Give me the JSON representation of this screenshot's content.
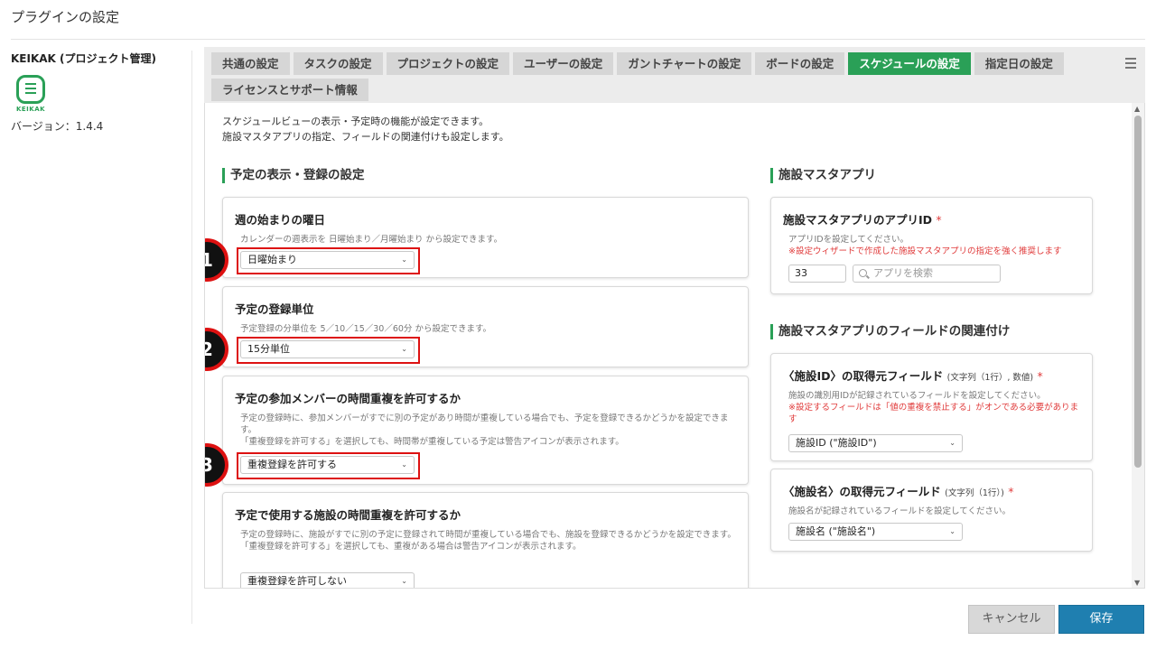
{
  "page_title": "プラグインの設定",
  "sidebar": {
    "plugin_name": "KEIKAK (プロジェクト管理)",
    "logo_text": "KEIKAK",
    "version": "バージョン：1.4.4"
  },
  "tabs": [
    {
      "label": "共通の設定",
      "active": false
    },
    {
      "label": "タスクの設定",
      "active": false
    },
    {
      "label": "プロジェクトの設定",
      "active": false
    },
    {
      "label": "ユーザーの設定",
      "active": false
    },
    {
      "label": "ガントチャートの設定",
      "active": false
    },
    {
      "label": "ボードの設定",
      "active": false
    },
    {
      "label": "スケジュールの設定",
      "active": true
    },
    {
      "label": "指定日の設定",
      "active": false
    },
    {
      "label": "ライセンスとサポート情報",
      "active": false
    }
  ],
  "intro": {
    "line1": "スケジュールビューの表示・予定時の機能が設定できます。",
    "line2": "施設マスタアプリの指定、フィールドの関連付けも設定します。"
  },
  "left_section": {
    "heading": "予定の表示・登録の設定",
    "cards": [
      {
        "title": "週の始まりの曜日",
        "desc1": "カレンダーの週表示を 日曜始まり／月曜始まり から設定できます。",
        "select_value": "日曜始まり",
        "badge": "1"
      },
      {
        "title": "予定の登録単位",
        "desc1": "予定登録の分単位を 5／10／15／30／60分 から設定できます。",
        "select_value": "15分単位",
        "badge": "2"
      },
      {
        "title": "予定の参加メンバーの時間重複を許可するか",
        "desc1": "予定の登録時に、参加メンバーがすでに別の予定があり時間が重複している場合でも、予定を登録できるかどうかを設定できます。",
        "desc2": "「重複登録を許可する」を選択しても、時間帯が重複している予定は警告アイコンが表示されます。",
        "select_value": "重複登録を許可する",
        "badge": "3"
      },
      {
        "title": "予定で使用する施設の時間重複を許可するか",
        "desc1": "予定の登録時に、施設がすでに別の予定に登録されて時間が重複している場合でも、施設を登録できるかどうかを設定できます。",
        "desc2": "「重複登録を許可する」を選択しても、重複がある場合は警告アイコンが表示されます。",
        "select_value": "重複登録を許可しない"
      }
    ]
  },
  "right_section": {
    "heading1": "施設マスタアプリ",
    "app_card": {
      "title": "施設マスタアプリのアプリID",
      "required_mark": "*",
      "desc1": "アプリIDを設定してください。",
      "warn": "※設定ウィザードで作成した施設マスタアプリの指定を強く推奨します",
      "app_id_value": "33",
      "search_placeholder": "アプリを検索"
    },
    "heading2": "施設マスタアプリのフィールドの関連付け",
    "field_cards": [
      {
        "title": "〈施設ID〉の取得元フィールド",
        "type_note": "(文字列（1行）, 数値)",
        "required_mark": "*",
        "desc1": "施設の識別用IDが記録されているフィールドを設定してください。",
        "warn": "※設定するフィールドは「値の重複を禁止する」がオンである必要があります",
        "select_value": "施設ID (\"施設ID\")"
      },
      {
        "title": "〈施設名〉の取得元フィールド",
        "type_note": "(文字列（1行）)",
        "required_mark": "*",
        "desc1": "施設名が記録されているフィールドを設定してください。",
        "select_value": "施設名 (\"施設名\")"
      }
    ]
  },
  "buttons": {
    "cancel": "キャンセル",
    "save": "保存"
  },
  "colors": {
    "accent_green": "#2aa057",
    "save_blue": "#1f7fb0",
    "highlight_red": "#dd1111"
  }
}
